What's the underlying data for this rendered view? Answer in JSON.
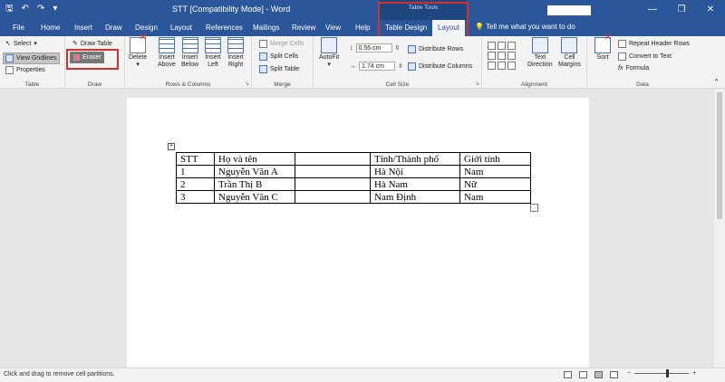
{
  "titlebar": {
    "title": "STT [Compatibility Mode]  -  Word",
    "contextual_group": "Table Tools",
    "qat": [
      "save-icon",
      "undo-icon",
      "redo-icon",
      "customize-icon"
    ],
    "controls": [
      "—",
      "❐",
      "✕"
    ]
  },
  "tabs": [
    {
      "label": "File"
    },
    {
      "label": "Home"
    },
    {
      "label": "Insert"
    },
    {
      "label": "Draw"
    },
    {
      "label": "Design"
    },
    {
      "label": "Layout"
    },
    {
      "label": "References"
    },
    {
      "label": "Mailings"
    },
    {
      "label": "Review"
    },
    {
      "label": "View"
    },
    {
      "label": "Help"
    },
    {
      "label": "Table Design"
    },
    {
      "label": "Layout"
    }
  ],
  "tell_me": "Tell me what you want to do",
  "ribbon": {
    "table": {
      "select": "Select",
      "view_gridlines": "View Gridlines",
      "properties": "Properties",
      "label": "Table"
    },
    "draw": {
      "draw_table": "Draw Table",
      "eraser": "Eraser",
      "label": "Draw"
    },
    "rows_columns": {
      "delete": "Delete",
      "insert_above": [
        "Insert",
        "Above"
      ],
      "insert_below": [
        "Insert",
        "Below"
      ],
      "insert_left": [
        "Insert",
        "Left"
      ],
      "insert_right": [
        "Insert",
        "Right"
      ],
      "label": "Rows & Columns"
    },
    "merge": {
      "merge_cells": "Merge Cells",
      "split_cells": "Split Cells",
      "split_table": "Split Table",
      "label": "Merge"
    },
    "cell_size": {
      "autofit": "AutoFit",
      "height": "0.56 cm",
      "width": "1.74 cm",
      "distribute_rows": "Distribute Rows",
      "distribute_columns": "Distribute Columns",
      "label": "Cell Size"
    },
    "alignment": {
      "text_direction": [
        "Text",
        "Direction"
      ],
      "cell_margins": [
        "Cell",
        "Margins"
      ],
      "label": "Alignment"
    },
    "data": {
      "sort": "Sort",
      "repeat_header": "Repeat Header Rows",
      "convert_to_text": "Convert to Text",
      "formula": "Formula",
      "label": "Data"
    }
  },
  "document": {
    "table": [
      [
        "STT",
        "Họ và tên",
        "",
        "Tỉnh/Thành phố",
        "Giới tính"
      ],
      [
        "1",
        "Nguyễn Văn A",
        "",
        "Hà Nội",
        "Nam"
      ],
      [
        "2",
        "Trần Thị B",
        "",
        "Hà Nam",
        "Nữ"
      ],
      [
        "3",
        "Nguyễn Văn C",
        "",
        "Nam Định",
        "Nam"
      ]
    ]
  },
  "status": {
    "text": "Click and drag to remove cell partitions.",
    "zoom_minus": "−",
    "zoom_plus": "+"
  },
  "colors": {
    "word_blue": "#2b579a",
    "highlight_red": "#d32f2f"
  }
}
